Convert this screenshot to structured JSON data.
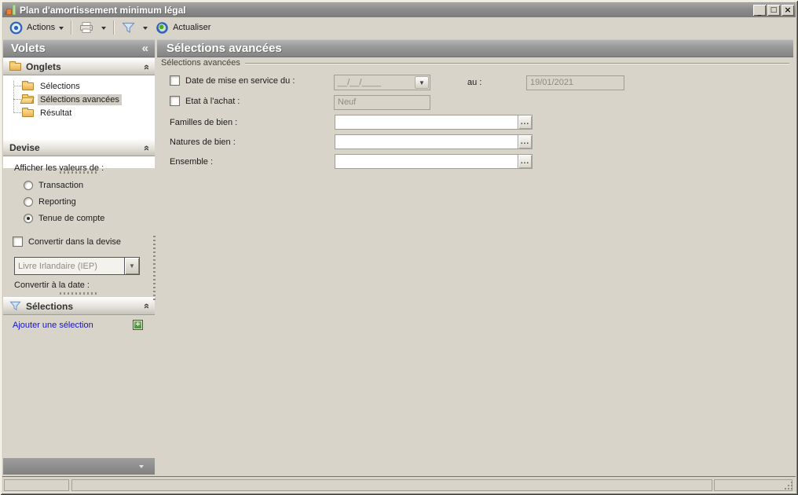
{
  "window": {
    "title": "Plan d'amortissement minimum légal",
    "controls": {
      "minimize": "_",
      "maximize": "□",
      "close": "×"
    }
  },
  "icons": {
    "panel_collapse": "«",
    "section_collapse": "»",
    "combo_arrow": "▼",
    "ellipsis": "..."
  },
  "toolbar": {
    "actions": "Actions",
    "refresh": "Actualiser"
  },
  "sidebar": {
    "title": "Volets",
    "onglets": {
      "title": "Onglets",
      "items": [
        {
          "label": "Sélections",
          "selected": false
        },
        {
          "label": "Sélections avancées",
          "selected": true
        },
        {
          "label": "Résultat",
          "selected": false
        }
      ]
    },
    "devise": {
      "title": "Devise",
      "display_values_label": "Afficher les valeurs de :",
      "radios": [
        {
          "label": "Transaction",
          "checked": false
        },
        {
          "label": "Reporting",
          "checked": false
        },
        {
          "label": "Tenue de compte",
          "checked": true
        }
      ],
      "convert_checkbox_label": "Convertir dans la devise",
      "convert_checked": false,
      "currency_value": "Livre Irlandaire (IEP)",
      "convert_date_label": "Convertir à la date :"
    },
    "selections": {
      "title": "Sélections",
      "add_link": "Ajouter une sélection"
    }
  },
  "main": {
    "title": "Sélections avancées",
    "group_title": "Sélections avancées",
    "date_row": {
      "checkbox_label": "Date de mise en service du :",
      "checked": false,
      "from_value": "__/__/____",
      "au_label": "au :",
      "to_value": "19/01/2021"
    },
    "etat_row": {
      "checkbox_label": "Etat à l'achat :",
      "checked": false,
      "value": "Neuf"
    },
    "familles_label": "Familles de bien :",
    "natures_label": "Natures de bien :",
    "ensemble_label": "Ensemble :"
  },
  "colors": {
    "background": "#d8d4ca",
    "titlebar_gray": "#8d8d8d",
    "accent_blue": "#2e62b8",
    "folder_yellow": "#f2c469",
    "link_blue": "#1414c8",
    "add_green": "#3f8f2f",
    "disabled_text": "#8d8b82"
  }
}
